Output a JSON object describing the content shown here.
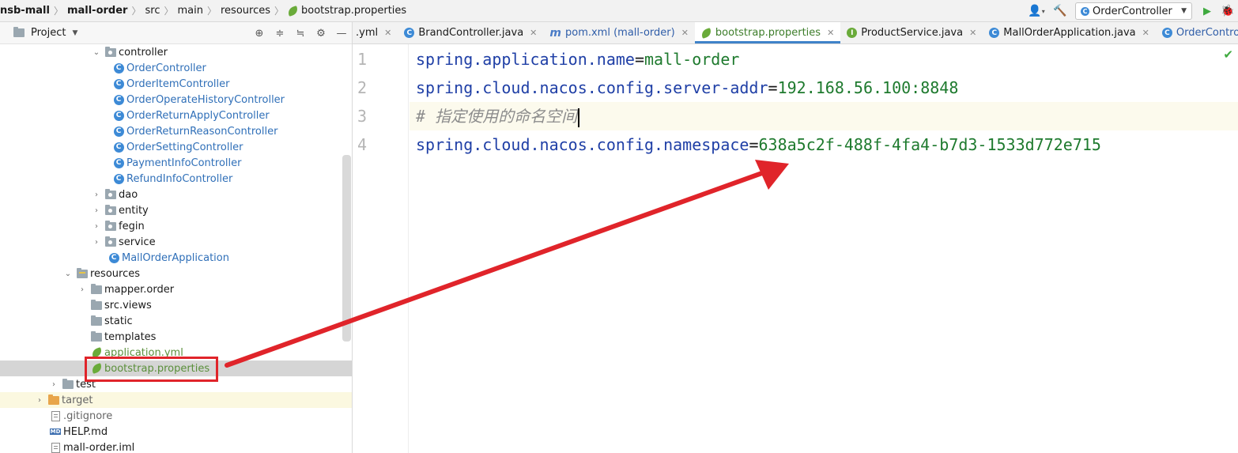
{
  "breadcrumb": {
    "items": [
      "nsb-mall",
      "mall-order",
      "src",
      "main",
      "resources",
      "bootstrap.properties"
    ]
  },
  "toolbar": {
    "run_config": "OrderController"
  },
  "project_panel": {
    "title": "Project"
  },
  "tree": {
    "controller": "controller",
    "classes": [
      "OrderController",
      "OrderItemController",
      "OrderOperateHistoryController",
      "OrderReturnApplyController",
      "OrderReturnReasonController",
      "OrderSettingController",
      "PaymentInfoController",
      "RefundInfoController"
    ],
    "packages": [
      "dao",
      "entity",
      "fegin",
      "service"
    ],
    "app_class": "MallOrderApplication",
    "resources": "resources",
    "res_children": [
      "mapper.order",
      "src.views",
      "static",
      "templates"
    ],
    "application_yml": "application.yml",
    "bootstrap_properties": "bootstrap.properties",
    "test": "test",
    "target": "target",
    "gitignore": ".gitignore",
    "help_md": "HELP.md",
    "iml": "mall-order.iml"
  },
  "editor_tabs": [
    {
      "label": ".yml"
    },
    {
      "label": "BrandController.java"
    },
    {
      "label": "pom.xml (mall-order)"
    },
    {
      "label": "bootstrap.properties"
    },
    {
      "label": "ProductService.java"
    },
    {
      "label": "MallOrderApplication.java"
    },
    {
      "label": "OrderController.java"
    }
  ],
  "code": {
    "line_numbers": [
      "1",
      "2",
      "3",
      "4"
    ],
    "l1_key": "spring.application.name",
    "l1_val": "mall-order",
    "l2_key": "spring.cloud.nacos.config.server-addr",
    "l2_val": "192.168.56.100:8848",
    "l3_comment": "# 指定使用的命名空间",
    "l4_key": "spring.cloud.nacos.config.namespace",
    "l4_val": "638a5c2f-488f-4fa4-b7d3-1533d772e715",
    "eq": "="
  },
  "colors": {
    "annotation": "#e0242a",
    "selection": "#d5d5d5",
    "key": "#1f3fa6",
    "value": "#1e7a2e"
  }
}
